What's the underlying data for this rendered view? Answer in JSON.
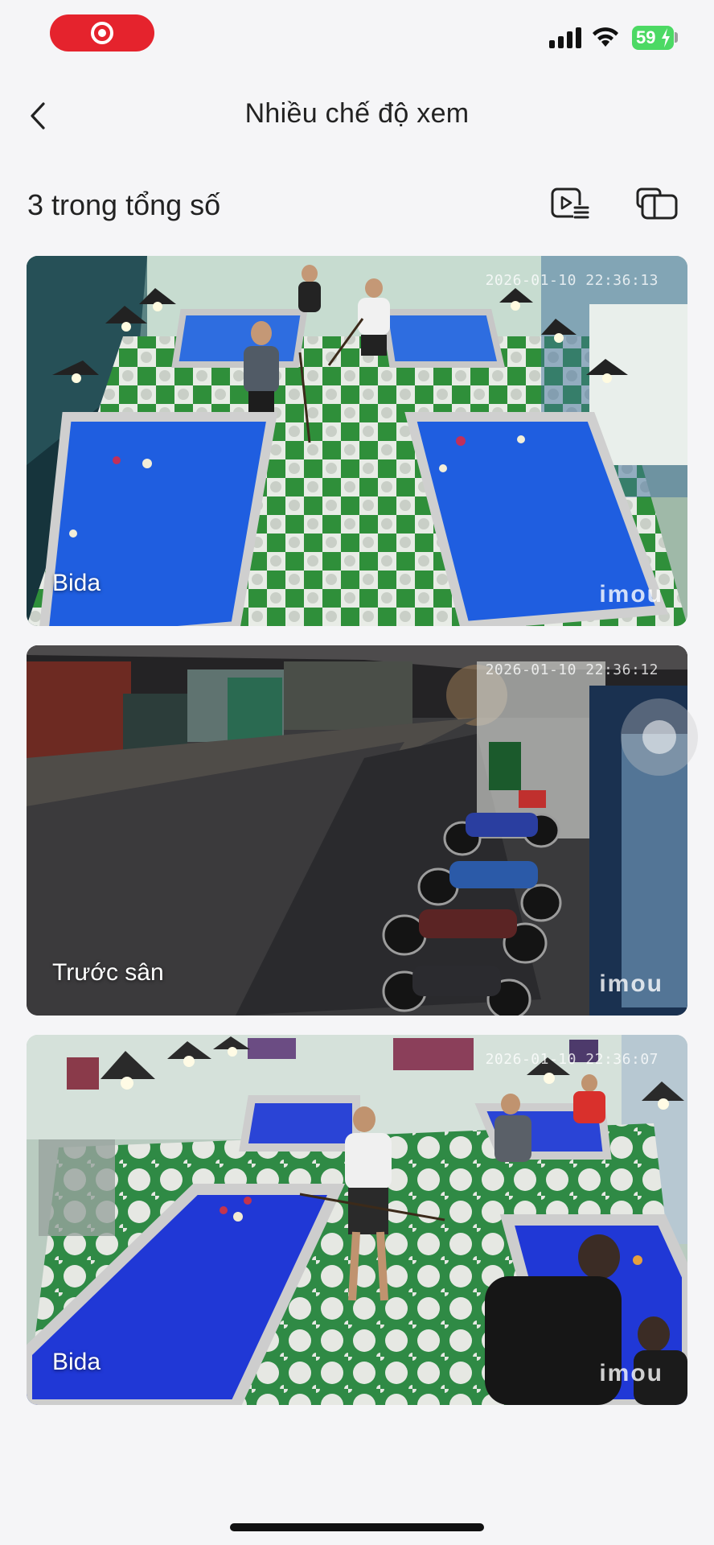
{
  "status_bar": {
    "battery_level": "59",
    "recording_color": "#e5232d",
    "battery_color": "#4cd964"
  },
  "header": {
    "title": "Nhiều chế độ xem",
    "back_icon": "chevron-left-icon"
  },
  "subheader": {
    "count_label": "3 trong tổng số",
    "playlist_icon": "playlist-play-icon",
    "split_icon": "split-view-icon"
  },
  "cameras": [
    {
      "name": "Bida",
      "timestamp": "2026-01-10 22:36:13",
      "brand": "imou"
    },
    {
      "name": "Trước sân",
      "timestamp": "2026-01-10 22:36:12",
      "brand": "imou"
    },
    {
      "name": "Bida",
      "timestamp": "2026-01-10 22:36:07",
      "brand": "imou"
    }
  ]
}
